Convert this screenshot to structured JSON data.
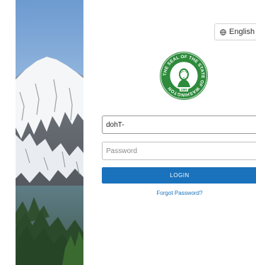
{
  "language": {
    "label": "English",
    "icon": "globe-icon"
  },
  "seal": {
    "ring_text": "THE SEAL OF THE STATE OF WASHINGTON",
    "year": "1889"
  },
  "login_form": {
    "username_value": "dohT-",
    "password_placeholder": "Password",
    "login_label": "LOGIN",
    "forgot_label": "Forgot Password?"
  },
  "colors": {
    "primary": "#1a72bc",
    "seal_green": "#2e8b3c",
    "text": "#333333"
  }
}
